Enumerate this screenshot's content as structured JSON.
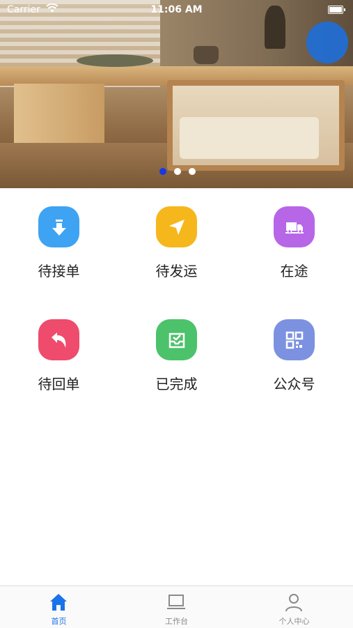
{
  "status_bar": {
    "carrier": "Carrier",
    "time": "11:06 AM"
  },
  "banner": {
    "page_count": 3,
    "active_page": 1
  },
  "menu": [
    {
      "label": "待接单",
      "icon": "download-arrow-icon",
      "color": "#3ea3f2"
    },
    {
      "label": "待发运",
      "icon": "navigation-arrow-icon",
      "color": "#f6b71c"
    },
    {
      "label": "在途",
      "icon": "truck-icon",
      "color": "#b766e8"
    },
    {
      "label": "待回单",
      "icon": "return-arrow-icon",
      "color": "#ef4b6c"
    },
    {
      "label": "已完成",
      "icon": "inbox-check-icon",
      "color": "#4cc26b"
    },
    {
      "label": "公众号",
      "icon": "qr-code-icon",
      "color": "#7c92e0"
    }
  ],
  "tabbar": {
    "items": [
      {
        "label": "首页",
        "icon": "home-icon",
        "active": true
      },
      {
        "label": "工作台",
        "icon": "laptop-icon",
        "active": false
      },
      {
        "label": "个人中心",
        "icon": "user-icon",
        "active": false
      }
    ],
    "active_color": "#1a73e8"
  }
}
